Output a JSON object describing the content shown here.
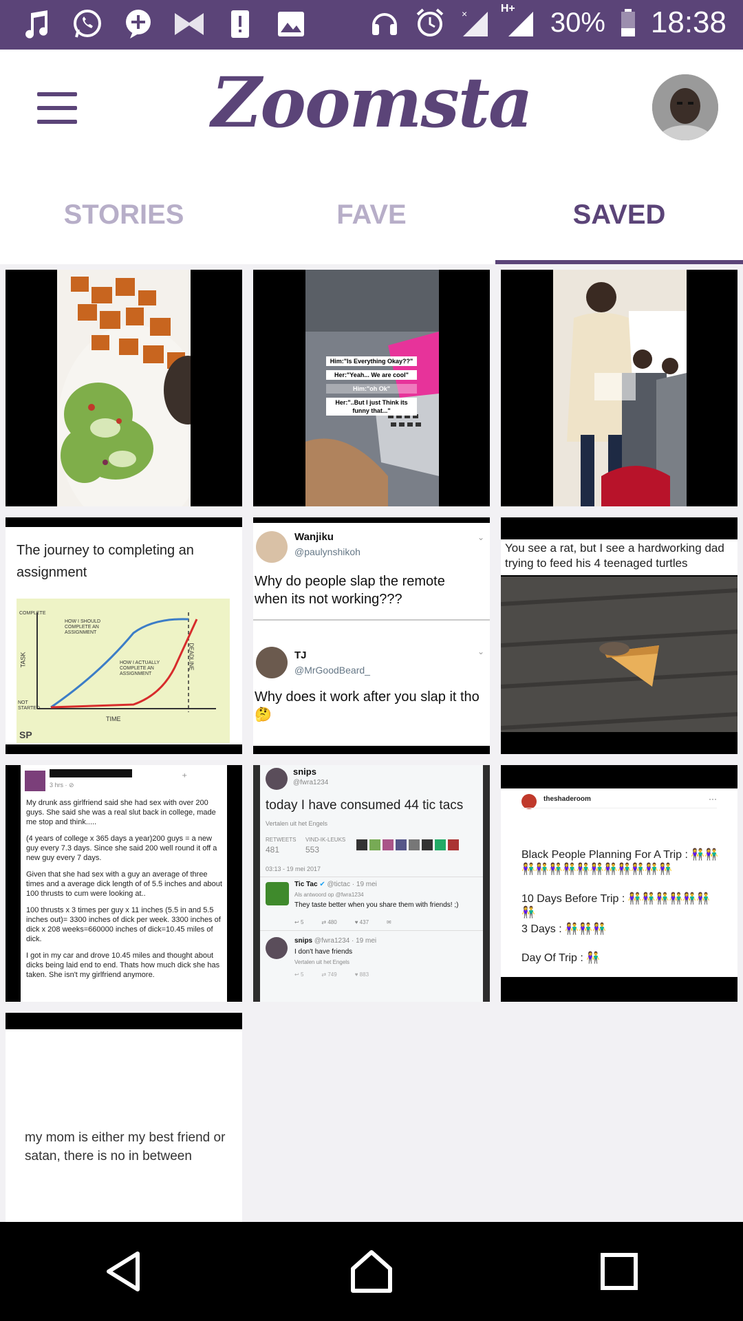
{
  "status_bar": {
    "battery": "30%",
    "time": "18:38",
    "network": "H+"
  },
  "app": {
    "title": "Zoomsta"
  },
  "tabs": [
    {
      "label": "STORIES"
    },
    {
      "label": "FAVE"
    },
    {
      "label": "SAVED"
    }
  ],
  "tiles": {
    "t2": {
      "c1": "Him:\"Is Everything Okay??\"",
      "c2": "Her:\"Yeah... We are cool\"",
      "c3": "Him:\"oh Ok\"",
      "c4": "Her:\"..But I just Think its funny that...\""
    },
    "t4": {
      "title": "The journey to completing an assignment",
      "y_top": "COMPLETE",
      "y_bottom": "NOT STARTED",
      "axis_y": "TASK",
      "axis_x": "TIME",
      "deadline": "DEADLINE",
      "should": "HOW I SHOULD COMPLETE AN ASSIGNMENT",
      "actually": "HOW I ACTUALLY COMPLETE AN ASSIGNMENT",
      "sign": "SP"
    },
    "t5": {
      "name1": "Wanjiku",
      "handle1": "@paulynshikoh",
      "text1": "Why do people slap the remote when its not working???",
      "name2": "TJ",
      "handle2": "@MrGoodBeard_",
      "text2": "Why does it work after you slap it tho 🤔"
    },
    "t6": {
      "caption": "You see a rat, but I see a hardworking dad trying to feed his 4 teenaged turtles"
    },
    "t7": {
      "meta": "3 hrs · ⊘",
      "p1": "My drunk ass girlfriend said she had sex with over 200 guys. She said she was a real slut back in college, made me stop and think.....",
      "p2": "(4 years of college x 365 days a year)200 guys = a new guy every 7.3 days. Since she said 200 well round it off a new guy every 7 days.",
      "p3": "Given that she had sex with a guy an average of three times and a average dick length of of 5.5 inches and about 100 thrusts to cum were looking at..",
      "p4": "100 thrusts x 3 times per guy x 11 inches (5.5 in and 5.5 inches out)= 3300 inches of dick per week. 3300 inches of dick x 208 weeks=660000 inches of dick=10.45 miles of dick.",
      "p5": "I got in my car and drove 10.45 miles and thought about dicks being laid end to end. Thats how much dick she has taken. She isn't my girlfriend anymore."
    },
    "t8": {
      "name": "snips",
      "handle": "@fwra1234",
      "text": "today I have consumed 44 tic tacs",
      "translate": "Vertalen uit het Engels",
      "rt_label": "RETWEETS",
      "rt": "481",
      "likes_label": "VIND-IK-LEUKS",
      "likes": "553",
      "date": "03:13 - 19 mei 2017",
      "reply_name": "Tic Tac",
      "reply_handle": "@tictac · 19 mei",
      "reply_to": "Als antwoord op @fwra1234",
      "reply_text": "They taste better when you share them with friends! ;)",
      "c_reply": "5",
      "c_rt": "480",
      "c_like": "437",
      "reply2_name": "snips",
      "reply2_handle": "@fwra1234 · 19 mei",
      "reply2_text": "I don't have friends",
      "reply2_translate": "Vertalen uit het Engels",
      "c2_reply": "5",
      "c2_rt": "749",
      "c2_like": "883"
    },
    "t9": {
      "account": "theshaderoom",
      "more": "···",
      "l1": "Black People Planning For A Trip : 👫👫👫👫👫👫👫👫👫👫👫👫👫",
      "l2": "10 Days Before Trip : 👫👫👫👫👫👫👫",
      "l3": "3 Days : 👫👫👫",
      "l4": "Day Of Trip : 👫"
    },
    "t10": {
      "text": "my mom is either my best friend or satan, there is no in between"
    }
  },
  "colors": {
    "primary": "#5b4478",
    "tab_inactive": "#b7aec8",
    "background": "#f2f1f4"
  },
  "icons": [
    "music-icon",
    "whatsapp-icon",
    "plus-icon",
    "bowtie-icon",
    "alert-icon",
    "gallery-icon",
    "headset-icon",
    "alarm-icon",
    "signal-icon",
    "battery-icon",
    "menu-icon",
    "back-icon",
    "home-icon",
    "recents-icon"
  ]
}
